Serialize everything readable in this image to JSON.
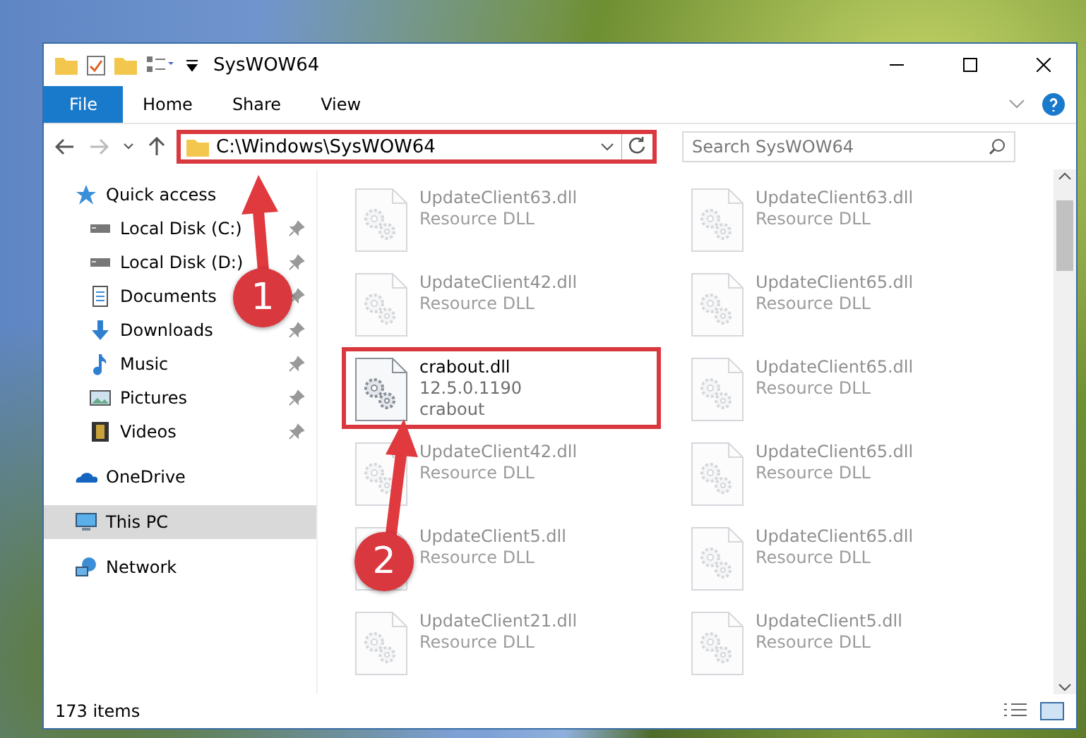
{
  "window": {
    "title": "SysWOW64"
  },
  "ribbon_tabs": [
    {
      "label": "File",
      "selected": true
    },
    {
      "label": "Home",
      "selected": false
    },
    {
      "label": "Share",
      "selected": false
    },
    {
      "label": "View",
      "selected": false
    }
  ],
  "address_bar": {
    "path": "C:\\Windows\\SysWOW64",
    "highlighted": true
  },
  "search": {
    "placeholder": "Search SysWOW64"
  },
  "sidebar": {
    "items": [
      {
        "label": "Quick access",
        "selected": false,
        "children": [
          {
            "label": "Local Disk (C:)",
            "pinned": true,
            "selected": false
          },
          {
            "label": "Local Disk (D:)",
            "pinned": true,
            "selected": false
          },
          {
            "label": "Documents",
            "pinned": true,
            "selected": false
          },
          {
            "label": "Downloads",
            "pinned": true,
            "selected": false
          },
          {
            "label": "Music",
            "pinned": true,
            "selected": false
          },
          {
            "label": "Pictures",
            "pinned": true,
            "selected": false
          },
          {
            "label": "Videos",
            "pinned": true,
            "selected": false
          }
        ]
      },
      {
        "label": "OneDrive",
        "selected": false
      },
      {
        "label": "This PC",
        "selected": true
      },
      {
        "label": "Network",
        "selected": false
      }
    ]
  },
  "files": [
    {
      "name": "UpdateClient63.dll",
      "lines": [
        "Resource DLL"
      ],
      "highlighted": false,
      "faded": true
    },
    {
      "name": "UpdateClient63.dll",
      "lines": [
        "Resource DLL"
      ],
      "highlighted": false,
      "faded": true
    },
    {
      "name": "UpdateClient42.dll",
      "lines": [
        "Resource DLL"
      ],
      "highlighted": false,
      "faded": true
    },
    {
      "name": "UpdateClient65.dll",
      "lines": [
        "Resource DLL"
      ],
      "highlighted": false,
      "faded": true
    },
    {
      "name": "crabout.dll",
      "lines": [
        "12.5.0.1190",
        "crabout"
      ],
      "highlighted": true,
      "faded": false
    },
    {
      "name": "UpdateClient65.dll",
      "lines": [
        "Resource DLL"
      ],
      "highlighted": false,
      "faded": true
    },
    {
      "name": "UpdateClient42.dll",
      "lines": [
        "Resource DLL"
      ],
      "highlighted": false,
      "faded": true
    },
    {
      "name": "UpdateClient65.dll",
      "lines": [
        "Resource DLL"
      ],
      "highlighted": false,
      "faded": true
    },
    {
      "name": "UpdateClient5.dll",
      "lines": [
        "Resource DLL"
      ],
      "highlighted": false,
      "faded": true
    },
    {
      "name": "UpdateClient65.dll",
      "lines": [
        "Resource DLL"
      ],
      "highlighted": false,
      "faded": true
    },
    {
      "name": "UpdateClient21.dll",
      "lines": [
        "Resource DLL"
      ],
      "highlighted": false,
      "faded": true
    },
    {
      "name": "UpdateClient5.dll",
      "lines": [
        "Resource DLL"
      ],
      "highlighted": false,
      "faded": true
    }
  ],
  "status_bar": {
    "count": "173 items"
  },
  "annotations": [
    {
      "label": "1"
    },
    {
      "label": "2"
    }
  ]
}
